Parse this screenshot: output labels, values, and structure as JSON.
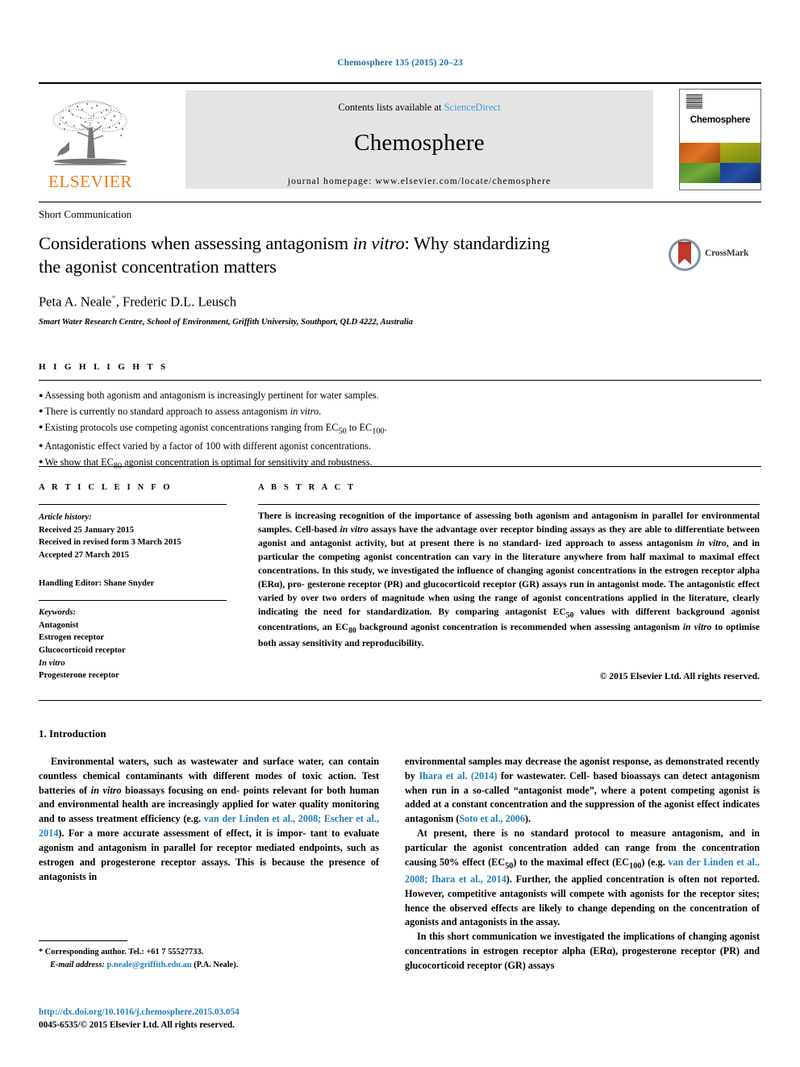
{
  "running_head": "Chemosphere 135 (2015) 20–23",
  "masthead": {
    "publisher_name": "ELSEVIER",
    "contents_prefix": "Contents lists available at",
    "sciencedirect": "ScienceDirect",
    "journal_name": "Chemosphere",
    "homepage": "journal homepage: www.elsevier.com/locate/chemosphere",
    "cover_title": "Chemosphere"
  },
  "article": {
    "type": "Short Communication",
    "title_line1": "Considerations when assessing antagonism ",
    "title_italic": "in vitro",
    "title_line2": ": Why standardizing",
    "title_line3": "the agonist concentration matters",
    "crossmark_label": "CrossMark",
    "authors_a": "Peta A. Neale",
    "authors_star": "*",
    "authors_b": ", Frederic D.L. Leusch",
    "affiliation": "Smart Water Research Centre, School of Environment, Griffith University, Southport, QLD 4222, Australia"
  },
  "highlights": {
    "heading": "H I G H L I G H T S",
    "items": [
      "Assessing both agonism and antagonism is increasingly pertinent for water samples.",
      "There is currently no standard approach to assess antagonism in vitro.",
      "Existing protocols use competing agonist concentrations ranging from EC50 to EC100.",
      "Antagonistic effect varied by a factor of 100 with different agonist concentrations.",
      "We show that EC80 agonist concentration is optimal for sensitivity and robustness."
    ]
  },
  "article_info": {
    "heading": "A R T I C L E   I N F O",
    "history_label": "Article history:",
    "received": "Received 25 January 2015",
    "revised": "Received in revised form 3 March 2015",
    "accepted": "Accepted 27 March 2015",
    "handling_editor": "Handling Editor: Shane Snyder",
    "keywords_label": "Keywords:",
    "keywords": [
      "Antagonist",
      "Estrogen receptor",
      "Glucocorticoid receptor",
      "In vitro",
      "Progesterone receptor"
    ]
  },
  "abstract": {
    "heading": "A B S T R A C T",
    "copyright": "© 2015 Elsevier Ltd. All rights reserved."
  },
  "body": {
    "section_heading": "1. Introduction",
    "refs": {
      "vdl_escher": "van der Linden et al., 2008; Escher et al., 2014",
      "ihara2014": "Ihara et al. (2014)",
      "soto2006": "Soto et al., 2006",
      "vdl_ihara": "van der Linden et al., 2008; Ihara et al., 2014"
    }
  },
  "footer": {
    "corresponding": "* Corresponding author. Tel.: +61 7 55527733.",
    "email_label": "E-mail address:",
    "email": "p.neale@griffith.edu.au",
    "email_suffix": "(P.A. Neale).",
    "doi": "http://dx.doi.org/10.1016/j.chemosphere.2015.03.054",
    "issn": "0045-6535/© 2015 Elsevier Ltd. All rights reserved."
  },
  "colors": {
    "link_blue": "#1f7fb8",
    "sciencedirect_blue": "#3b9ed4",
    "elsevier_orange": "#f07d10",
    "banner_grey": "#e4e4e4"
  }
}
